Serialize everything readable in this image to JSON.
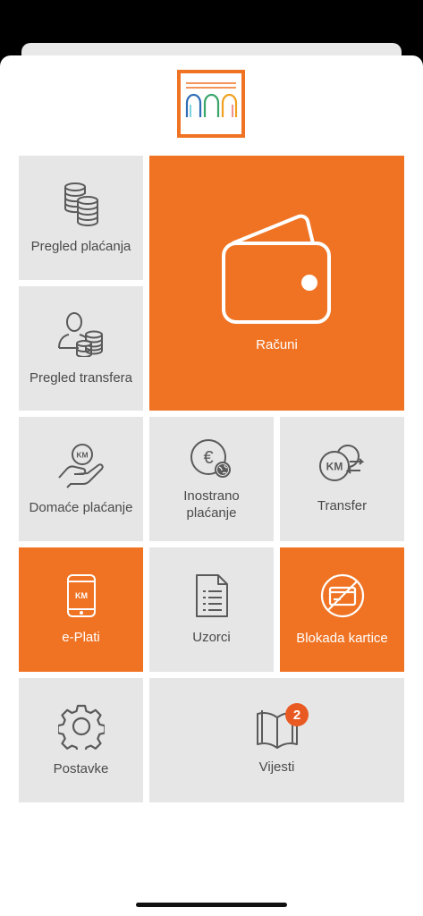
{
  "tiles": {
    "pregled_placanja": "Pregled plaćanja",
    "racuni": "Računi",
    "pregled_transfera": "Pregled transfera",
    "domace_placanje": "Domaće plaćanje",
    "inostrano_placanje": "Inostrano plaćanje",
    "transfer": "Transfer",
    "e_plati": "e-Plati",
    "uzorci": "Uzorci",
    "blokada_kartice": "Blokada kartice",
    "postavke": "Postavke",
    "vijesti": "Vijesti"
  },
  "icon_text": {
    "currency": "KM",
    "euro": "€"
  },
  "vijesti_badge": "2",
  "colors": {
    "accent": "#f07323",
    "tile_gray": "#e6e6e6",
    "text_gray": "#4a4a4a",
    "badge": "#e85a22"
  },
  "icons": {
    "pregled_placanja": "coins-stack-icon",
    "racuni": "wallet-icon",
    "pregled_transfera": "person-coins-icon",
    "domace_placanje": "hand-coin-icon",
    "inostrano_placanje": "euro-globe-icon",
    "transfer": "currency-exchange-icon",
    "e_plati": "mobile-phone-icon",
    "uzorci": "document-list-icon",
    "blokada_kartice": "blocked-card-icon",
    "postavke": "gear-icon",
    "vijesti": "open-book-icon"
  }
}
